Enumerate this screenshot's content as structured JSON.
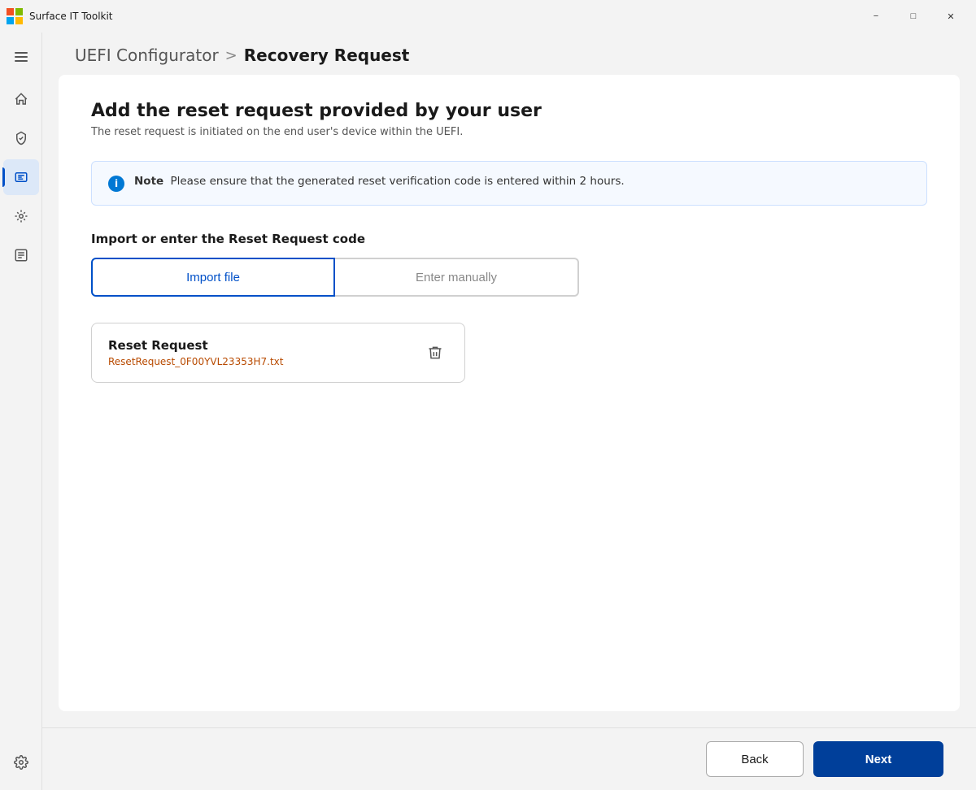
{
  "titlebar": {
    "app_name": "Surface IT Toolkit",
    "minimize_label": "−",
    "maximize_label": "□",
    "close_label": "✕"
  },
  "sidebar": {
    "items": [
      {
        "id": "menu",
        "icon": "hamburger",
        "label": "Menu"
      },
      {
        "id": "home",
        "icon": "home",
        "label": "Home"
      },
      {
        "id": "updates",
        "icon": "shield-update",
        "label": "Updates"
      },
      {
        "id": "uefi",
        "icon": "uefi",
        "label": "UEFI Configurator",
        "active": true
      },
      {
        "id": "deploy",
        "icon": "deploy",
        "label": "Deploy"
      },
      {
        "id": "reports",
        "icon": "reports",
        "label": "Reports"
      }
    ],
    "bottom": [
      {
        "id": "settings",
        "icon": "gear",
        "label": "Settings"
      }
    ]
  },
  "breadcrumb": {
    "parent": "UEFI Configurator",
    "separator": ">",
    "current": "Recovery Request"
  },
  "main": {
    "section_title": "Add the reset request provided by your user",
    "section_subtitle": "The reset request is initiated on the end user's device within the UEFI.",
    "note": {
      "label": "Note",
      "text": "Please ensure that the generated reset verification code is entered within 2 hours."
    },
    "import_label": "Import or enter the Reset Request code",
    "toggle_import": "Import file",
    "toggle_manual": "Enter manually",
    "file_card": {
      "title": "Reset Request",
      "filename": "ResetRequest_0F00YVL23353H7.txt"
    }
  },
  "footer": {
    "back_label": "Back",
    "next_label": "Next"
  }
}
